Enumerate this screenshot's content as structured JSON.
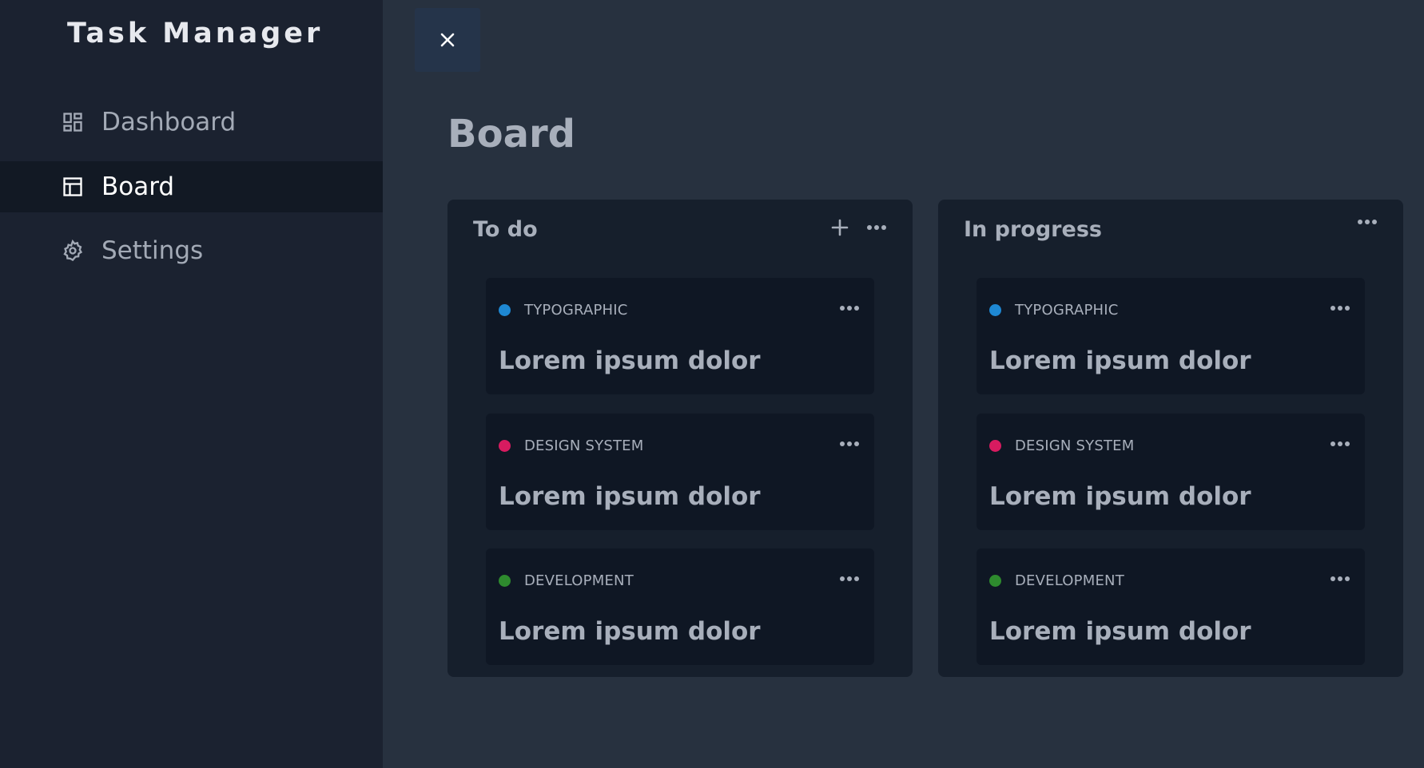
{
  "app": {
    "title": "Task Manager"
  },
  "sidebar": {
    "items": [
      {
        "label": "Dashboard",
        "icon": "dashboard-icon",
        "active": false
      },
      {
        "label": "Board",
        "icon": "board-icon",
        "active": true
      },
      {
        "label": "Settings",
        "icon": "gear-icon",
        "active": false
      }
    ]
  },
  "main": {
    "close_icon": "close-icon",
    "page_title": "Board",
    "columns": [
      {
        "title": "To do",
        "actions": [
          "plus-icon",
          "more-icon"
        ],
        "cards": [
          {
            "tag": "TYPOGRAPHIC",
            "tag_color": "#1e88d3",
            "title": "Lorem ipsum dolor"
          },
          {
            "tag": "DESIGN SYSTEM",
            "tag_color": "#d81b60",
            "title": "Lorem ipsum dolor"
          },
          {
            "tag": "DEVELOPMENT",
            "tag_color": "#2e8b2e",
            "title": "Lorem ipsum dolor"
          }
        ]
      },
      {
        "title": "In progress",
        "actions": [
          "more-icon"
        ],
        "cards": [
          {
            "tag": "TYPOGRAPHIC",
            "tag_color": "#1e88d3",
            "title": "Lorem ipsum dolor"
          },
          {
            "tag": "DESIGN SYSTEM",
            "tag_color": "#d81b60",
            "title": "Lorem ipsum dolor"
          },
          {
            "tag": "DEVELOPMENT",
            "tag_color": "#2e8b2e",
            "title": "Lorem ipsum dolor"
          }
        ]
      }
    ]
  },
  "colors": {
    "sidebar_bg": "#1b2230",
    "main_bg": "#27313f",
    "column_bg": "#161f2c",
    "card_bg": "#0f1724",
    "active_nav_bg": "#121924"
  }
}
